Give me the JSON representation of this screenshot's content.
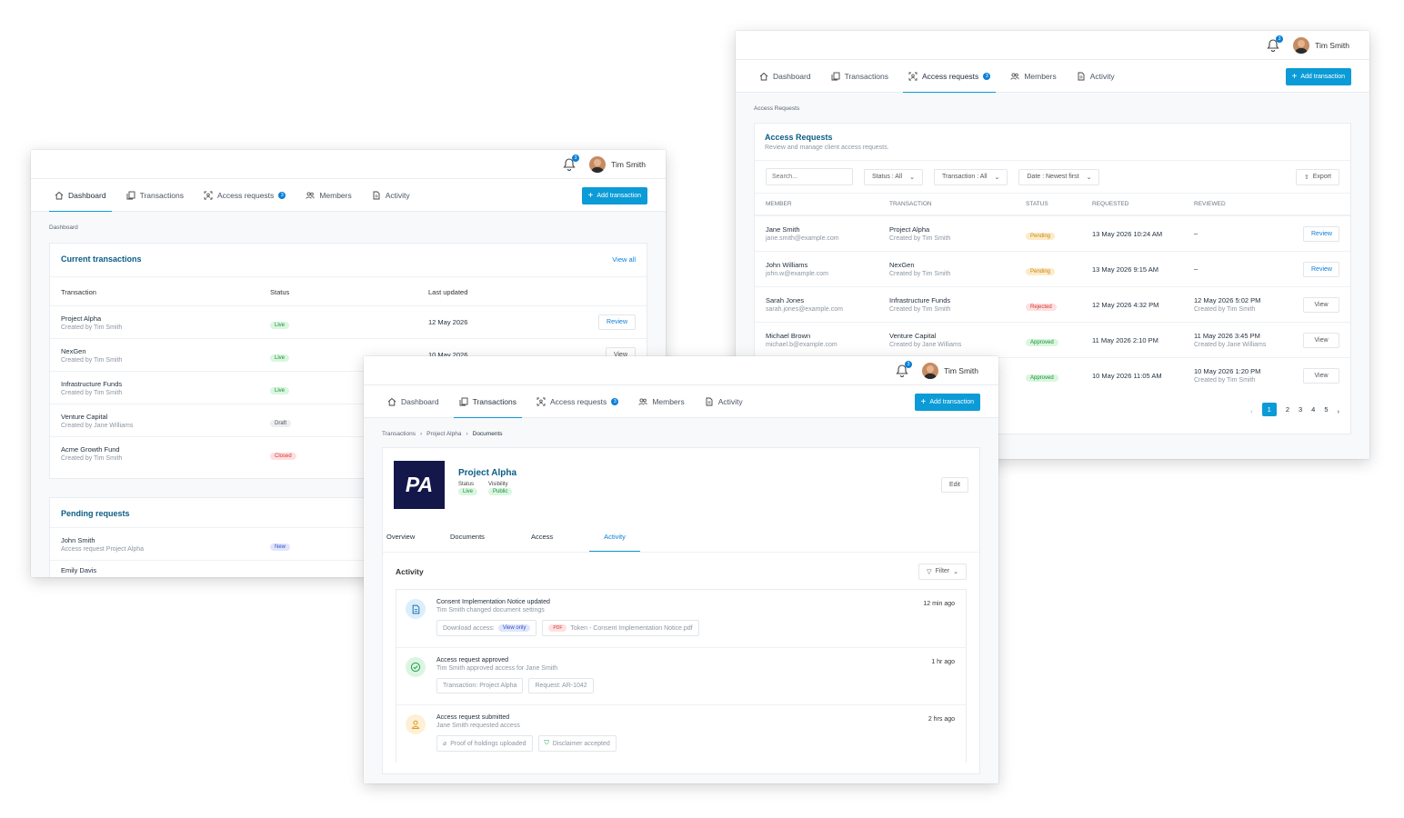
{
  "user": {
    "name": "Tim Smith",
    "notifications": "3"
  },
  "nav": {
    "dashboard": "Dashboard",
    "transactions": "Transactions",
    "access_requests": "Access requests",
    "access_badge": "3",
    "members": "Members",
    "activity": "Activity",
    "add_transaction": "Add transaction"
  },
  "dashboard": {
    "breadcrumb": "Dashboard",
    "current_title": "Current transactions",
    "view_all": "View all",
    "headers": [
      "Transaction",
      "Status",
      "Last updated"
    ],
    "rows": [
      {
        "name": "Project Alpha",
        "sub": "Created by Tim Smith",
        "status": "Live",
        "updated": "12 May 2026",
        "action": "Review"
      },
      {
        "name": "NexGen",
        "sub": "Created by Tim Smith",
        "status": "Live",
        "updated": "10 May 2026",
        "action": "View"
      },
      {
        "name": "Infrastructure Funds",
        "sub": "Created by Tim Smith",
        "status": "Live",
        "updated": "",
        "action": ""
      },
      {
        "name": "Venture Capital",
        "sub": "Created by Jane Williams",
        "status": "Draft",
        "updated": "",
        "action": ""
      },
      {
        "name": "Acme Growth Fund",
        "sub": "Created by Tim Smith",
        "status": "Closed",
        "updated": "",
        "action": ""
      }
    ],
    "pending_title": "Pending requests",
    "pending": [
      {
        "name": "John Smith",
        "sub": "Access request Project Alpha",
        "status": "New"
      },
      {
        "name": "Emily Davis",
        "sub": "",
        "status": ""
      }
    ]
  },
  "access": {
    "breadcrumb": "Access Requests",
    "title": "Access Requests",
    "subtitle": "Review and manage client access requests.",
    "search_placeholder": "Search...",
    "filter_status": "Status : All",
    "filter_transaction": "Transaction : All",
    "filter_date": "Date : Newest first",
    "export": "Export",
    "headers": [
      "MEMBER",
      "TRANSACTION",
      "STATUS",
      "REQUESTED",
      "REVIEWED"
    ],
    "rows": [
      {
        "member": "Jane Smith",
        "email": "jane.smith@example.com",
        "tx": "Project Alpha",
        "tx_sub": "Created by Tim Smith",
        "status": "Pending",
        "requested": "13 May 2026 10:24 AM",
        "reviewed": "–",
        "reviewed_sub": "",
        "action": "Review"
      },
      {
        "member": "John Williams",
        "email": "john.w@example.com",
        "tx": "NexGen",
        "tx_sub": "Created by Tim Smith",
        "status": "Pending",
        "requested": "13 May 2026 9:15 AM",
        "reviewed": "–",
        "reviewed_sub": "",
        "action": "Review"
      },
      {
        "member": "Sarah Jones",
        "email": "sarah.jones@example.com",
        "tx": "Infrastructure Funds",
        "tx_sub": "Created by Tim Smith",
        "status": "Rejected",
        "requested": "12 May 2026 4:32 PM",
        "reviewed": "12 May 2026 5:02 PM",
        "reviewed_sub": "Created by Tim Smith",
        "action": "View"
      },
      {
        "member": "Michael Brown",
        "email": "michael.b@example.com",
        "tx": "Venture Capital",
        "tx_sub": "Created by Jane Williams",
        "status": "Approved",
        "requested": "11 May 2026 2:10 PM",
        "reviewed": "11 May 2026 3:45 PM",
        "reviewed_sub": "Created by Jane Williams",
        "action": "View"
      },
      {
        "member": "",
        "email": "",
        "tx": "",
        "tx_sub": "",
        "status": "Approved",
        "requested": "10 May 2026 11:05 AM",
        "reviewed": "10 May 2026 1:20 PM",
        "reviewed_sub": "Created by Tim Smith",
        "action": "View"
      }
    ],
    "pages": [
      "1",
      "2",
      "3",
      "4",
      "5"
    ],
    "current_page": "1"
  },
  "project": {
    "crumbs": [
      "Transactions",
      "Project Alpha",
      "Documents"
    ],
    "logo": "PA",
    "name": "Project Alpha",
    "status_label": "Status",
    "visibility_label": "Visibility",
    "status": "Live",
    "visibility": "Public",
    "edit": "Edit",
    "tabs": [
      "Overview",
      "Documents",
      "Access",
      "Activity"
    ],
    "activity_title": "Activity",
    "filter": "Filter",
    "items": [
      {
        "title": "Consent Implementation Notice updated",
        "sub": "Tim Smith changed document settings",
        "time": "12 min ago",
        "chip1_label": "Download access:",
        "chip1_badge": "View only",
        "chip2_tag": "PDF",
        "chip2_text": "Token - Consent Implementation Notice.pdf"
      },
      {
        "title": "Access request approved",
        "sub": "Tim Smith approved access for Jane Smith",
        "time": "1 hr ago",
        "chip1": "Transaction: Project Alpha",
        "chip2": "Request: AR-1042"
      },
      {
        "title": "Access request submitted",
        "sub": "Jane Smith requested access",
        "time": "2 hrs ago",
        "chip1": "Proof of holdings uploaded",
        "chip2": "Disclaimer accepted"
      }
    ]
  },
  "colors": {
    "accent": "#0b9bd6",
    "title_blue": "#0a5c86",
    "logo_bg": "#13174a"
  }
}
